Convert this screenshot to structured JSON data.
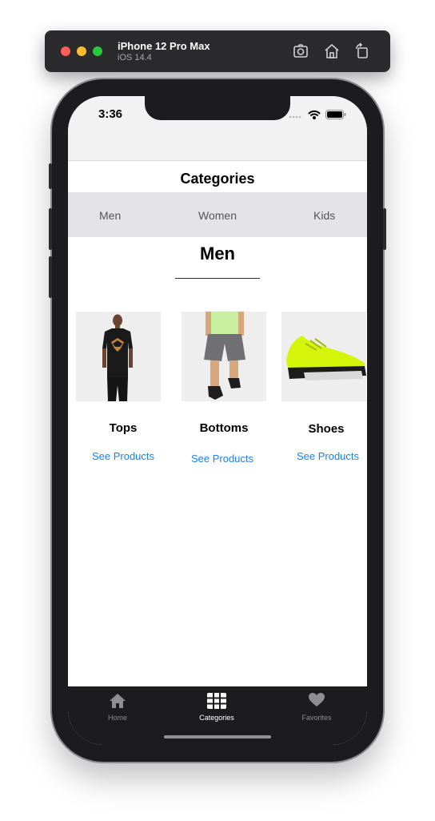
{
  "simulator": {
    "device_name": "iPhone 12 Pro Max",
    "os_version": "iOS 14.4",
    "icons": [
      "screenshot-icon",
      "home-icon",
      "rotate-icon"
    ]
  },
  "status_bar": {
    "time": "3:36"
  },
  "nav": {
    "title": "Categories"
  },
  "tabs": [
    {
      "label": "Men"
    },
    {
      "label": "Women"
    },
    {
      "label": "Kids"
    }
  ],
  "section": {
    "title": "Men"
  },
  "categories": [
    {
      "label": "Tops",
      "link": "See Products",
      "image": "black-tshirt-model"
    },
    {
      "label": "Bottoms",
      "link": "See Products",
      "image": "grey-shorts-model"
    },
    {
      "label": "Shoes",
      "link": "See Products",
      "image": "neon-yellow-sneaker"
    }
  ],
  "tab_bar": {
    "items": [
      {
        "label": "Home",
        "icon": "house-icon",
        "active": false
      },
      {
        "label": "Categories",
        "icon": "grid-icon",
        "active": true
      },
      {
        "label": "Favorites",
        "icon": "heart-icon",
        "active": false
      }
    ]
  },
  "colors": {
    "link": "#1a82e8",
    "tab_bar_bg": "#1c1c1e",
    "segment_bg": "#e4e4e8",
    "shoe_accent": "#d4f50a"
  }
}
